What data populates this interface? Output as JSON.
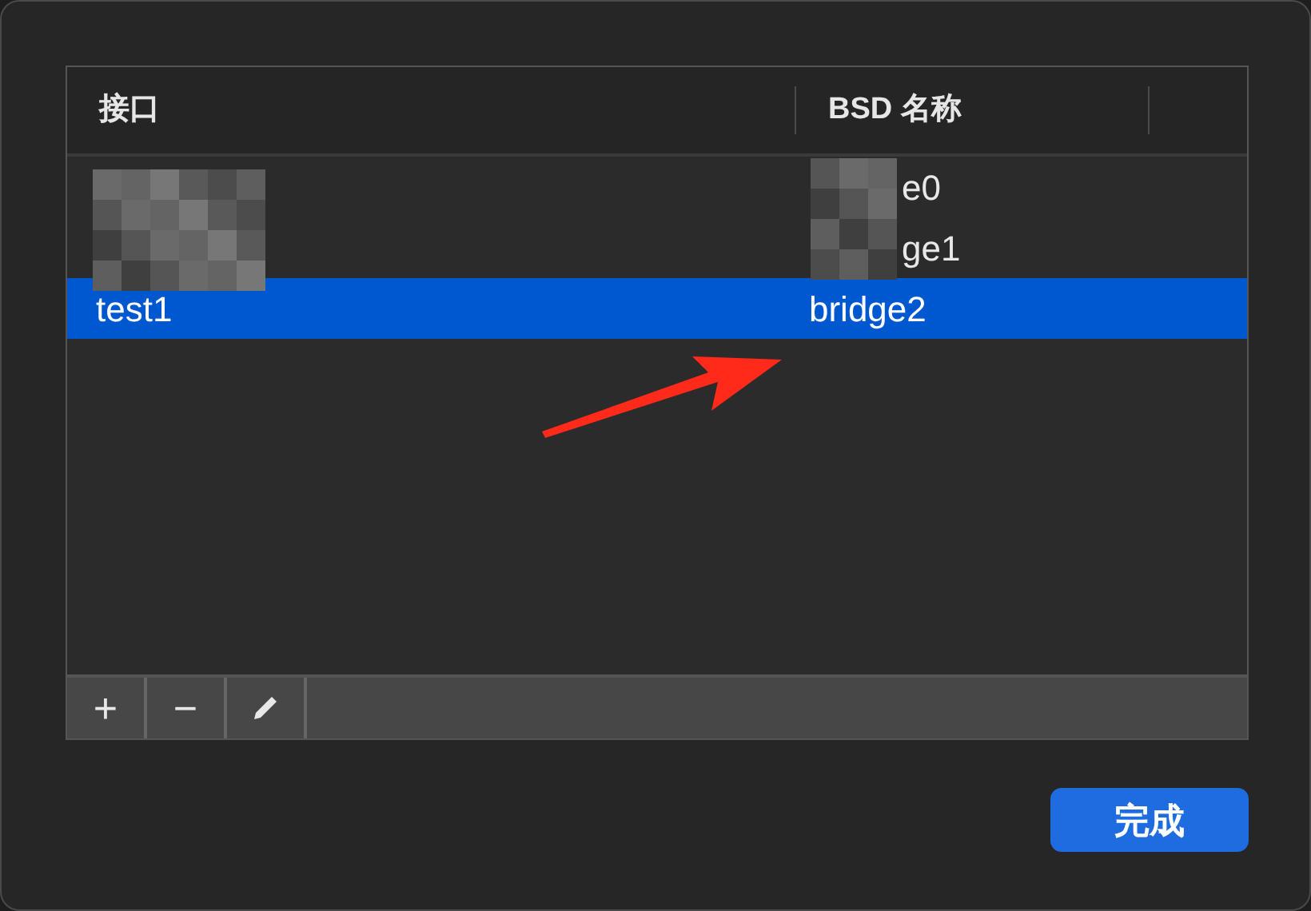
{
  "table": {
    "columns": [
      {
        "label": "接口"
      },
      {
        "label": "BSD 名称"
      }
    ],
    "rows": [
      {
        "redacted": true,
        "bsd_name": "e0",
        "selected": false
      },
      {
        "redacted": true,
        "bsd_name": "ge1",
        "selected": false
      },
      {
        "redacted": false,
        "interface": "test1",
        "bsd_name": "bridge2",
        "selected": true
      }
    ]
  },
  "toolbar": [
    {
      "kind": "text",
      "label": "+"
    },
    {
      "kind": "text",
      "label": "−"
    },
    {
      "kind": "pencil"
    }
  ],
  "annotation": {
    "kind": "arrow"
  },
  "buttons": [
    {
      "label": "完成"
    }
  ]
}
